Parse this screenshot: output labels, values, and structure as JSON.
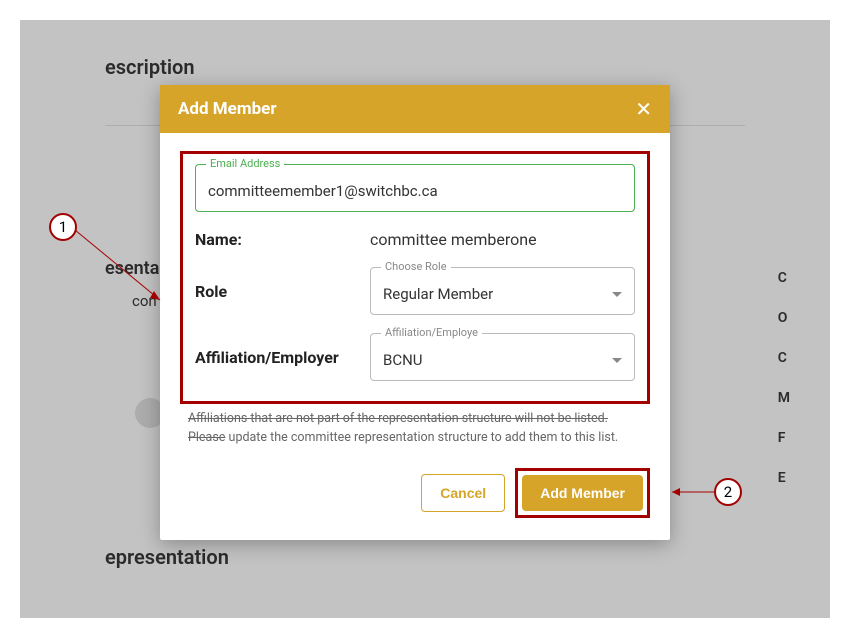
{
  "background": {
    "title1": "escription",
    "sub1": "esenta",
    "sub2": "con",
    "title2": "epresentation",
    "col": [
      "C",
      "O",
      "C",
      "M",
      "F",
      "E"
    ]
  },
  "modal": {
    "title": "Add Member",
    "email": {
      "legend": "Email Address",
      "value": "committeemember1@switchbc.ca"
    },
    "name": {
      "label": "Name:",
      "value": "committee memberone"
    },
    "role": {
      "label": "Role",
      "legend": "Choose Role",
      "value": "Regular Member"
    },
    "affiliation": {
      "label": "Affiliation/Employer",
      "legend": "Affiliation/Employe",
      "value": "BCNU"
    },
    "helper1": "Affiliations that are not part of the representation structure will not be listed. Please",
    "helper2": "update the committee representation structure to add them to this list.",
    "cancel": "Cancel",
    "add": "Add Member"
  },
  "callouts": {
    "one": "1",
    "two": "2"
  }
}
